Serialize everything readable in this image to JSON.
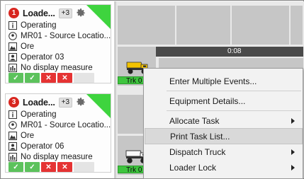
{
  "loaders": [
    {
      "alert_count": "1",
      "title": "Loade...",
      "extra_count": "+3",
      "state": "Operating",
      "location": "MR01 - Source Locatio...",
      "material": "Ore",
      "operator": "Operator 03",
      "measure": "No display measure"
    },
    {
      "alert_count": "3",
      "title": "Loade...",
      "extra_count": "+3",
      "state": "Operating",
      "location": "MR01 - Source Locatio...",
      "material": "Ore",
      "operator": "Operator 06",
      "measure": "No display measure"
    }
  ],
  "action_buttons": {
    "accept_symbol": "✓",
    "reject_symbol": "✕"
  },
  "map": {
    "timer": "0:08",
    "trucks": [
      {
        "label": "Trk 0"
      },
      {
        "label": "Trk 0"
      }
    ]
  },
  "context_menu": {
    "items": [
      {
        "label": "Enter Multiple Events...",
        "submenu": false
      },
      {
        "label": "Equipment Details...",
        "submenu": false
      },
      {
        "label": "Allocate Task",
        "submenu": true
      },
      {
        "label": "Print Task List...",
        "submenu": false,
        "highlighted": true
      },
      {
        "label": "Dispatch Truck",
        "submenu": true
      },
      {
        "label": "Loader Lock",
        "submenu": true
      }
    ]
  },
  "colors": {
    "status_green": "#3ed43e",
    "alert_red": "#d8261f",
    "accept_green": "#5cc25c",
    "reject_red": "#e53333",
    "truck_yellow": "#f2c200"
  }
}
